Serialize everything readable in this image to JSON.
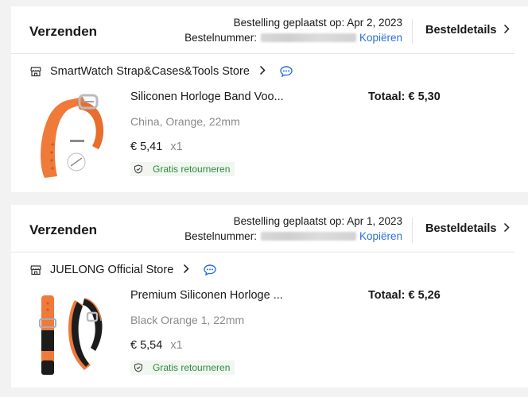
{
  "orders": [
    {
      "status": "Verzenden",
      "placed": "Bestelling geplaatst op: Apr 2, 2023",
      "order_number_label": "Bestelnummer:",
      "copy_label": "Kopiëren",
      "details_label": "Besteldetails",
      "store": "SmartWatch Strap&Cases&Tools Store",
      "product_title": "Siliconen Horloge Band Voo...",
      "sku": "China, Orange, 22mm",
      "price": "€ 5,41",
      "quantity": "x1",
      "badge": "Gratis retourneren",
      "total": "Totaal: € 5,30"
    },
    {
      "status": "Verzenden",
      "placed": "Bestelling geplaatst op: Apr 1, 2023",
      "order_number_label": "Bestelnummer:",
      "copy_label": "Kopiëren",
      "details_label": "Besteldetails",
      "store": "JUELONG Official Store",
      "product_title": "Premium Siliconen Horloge ...",
      "sku": "Black Orange 1, 22mm",
      "price": "€ 5,54",
      "quantity": "x1",
      "badge": "Gratis retourneren",
      "total": "Totaal: € 5,26"
    }
  ],
  "icons": {
    "store": "store-icon",
    "chat": "chat-bubble-icon",
    "chevron": "chevron-right-icon",
    "return": "shield-check-icon"
  },
  "colors": {
    "accent_link": "#2c6fe0",
    "badge_text": "#2e8b3f",
    "product_orange": "#ef7a3a"
  }
}
